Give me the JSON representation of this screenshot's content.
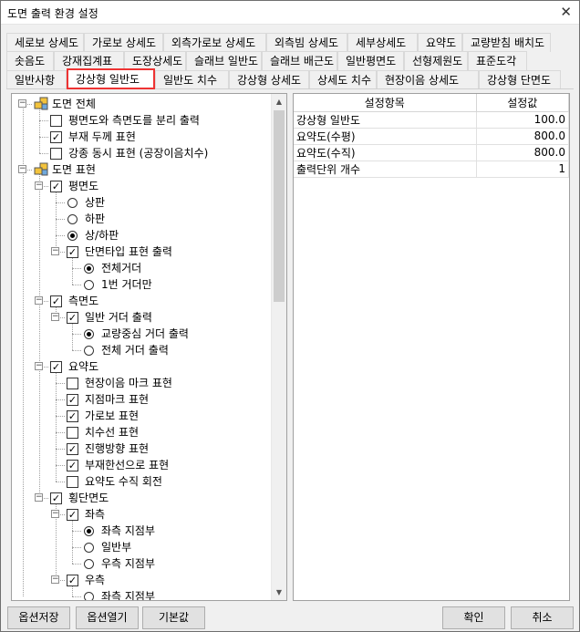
{
  "window": {
    "title": "도면 출력 환경 설정",
    "close_glyph": "✕"
  },
  "tabs_row1": [
    "세로보 상세도",
    "가로보 상세도",
    "외측가로보 상세도",
    "외측빔 상세도",
    "세부상세도",
    "요약도",
    "교량받침 배치도"
  ],
  "tabs_row2": [
    "솟음도",
    "강재집계표",
    "도장상세도",
    "슬래브 일반도",
    "슬래브 배근도",
    "일반평면도",
    "선형제원도",
    "표준도각"
  ],
  "tabs_row3": [
    "일반사항",
    "강상형 일반도",
    "일반도 치수",
    "강상형 상세도",
    "상세도 치수",
    "현장이음 상세도",
    "강상형 단면도"
  ],
  "active_tab": "강상형 일반도",
  "tree": [
    {
      "label": "도면 전체",
      "type": "group"
    },
    {
      "label": "평면도와 측면도를 분리 출력",
      "type": "check",
      "checked": false
    },
    {
      "label": "부재 두께 표현",
      "type": "check",
      "checked": true
    },
    {
      "label": "강종 동시 표현 (공장이음치수)",
      "type": "check",
      "checked": false
    },
    {
      "label": "도면 표현",
      "type": "group"
    },
    {
      "label": "평면도",
      "type": "check",
      "checked": true
    },
    {
      "label": "상판",
      "type": "radio",
      "checked": false
    },
    {
      "label": "하판",
      "type": "radio",
      "checked": false
    },
    {
      "label": "상/하판",
      "type": "radio",
      "checked": true
    },
    {
      "label": "단면타입 표현 출력",
      "type": "check",
      "checked": true
    },
    {
      "label": "전체거더",
      "type": "radio",
      "checked": true
    },
    {
      "label": "1번 거더만",
      "type": "radio",
      "checked": false
    },
    {
      "label": "측면도",
      "type": "check",
      "checked": true
    },
    {
      "label": "일반 거더 출력",
      "type": "check",
      "checked": true
    },
    {
      "label": "교량중심 거더 출력",
      "type": "radio",
      "checked": true
    },
    {
      "label": "전체 거더 출력",
      "type": "radio",
      "checked": false
    },
    {
      "label": "요약도",
      "type": "check",
      "checked": true
    },
    {
      "label": "현장이음 마크 표현",
      "type": "check",
      "checked": false
    },
    {
      "label": "지점마크 표현",
      "type": "check",
      "checked": true
    },
    {
      "label": "가로보 표현",
      "type": "check",
      "checked": true
    },
    {
      "label": "치수선 표현",
      "type": "check",
      "checked": false
    },
    {
      "label": "진행방향 표현",
      "type": "check",
      "checked": true
    },
    {
      "label": "부재한선으로 표현",
      "type": "check",
      "checked": true
    },
    {
      "label": "요약도 수직 회전",
      "type": "check",
      "checked": false
    },
    {
      "label": "횡단면도",
      "type": "check",
      "checked": true
    },
    {
      "label": "좌측",
      "type": "check",
      "checked": true
    },
    {
      "label": "좌측 지점부",
      "type": "radio",
      "checked": true
    },
    {
      "label": "일반부",
      "type": "radio",
      "checked": false
    },
    {
      "label": "우측 지점부",
      "type": "radio",
      "checked": false
    },
    {
      "label": "우측",
      "type": "check",
      "checked": true
    },
    {
      "label": "좌측 지점부",
      "type": "radio",
      "checked": false
    }
  ],
  "grid": {
    "headers": [
      "설정항목",
      "설정값"
    ],
    "rows": [
      {
        "item": "강상형 일반도",
        "value": "100.0"
      },
      {
        "item": "요약도(수평)",
        "value": "800.0"
      },
      {
        "item": "요약도(수직)",
        "value": "800.0"
      },
      {
        "item": "출력단위 개수",
        "value": "1"
      }
    ]
  },
  "buttons": {
    "save": "옵션저장",
    "open": "옵션열기",
    "default": "기본값",
    "ok": "확인",
    "cancel": "취소"
  }
}
